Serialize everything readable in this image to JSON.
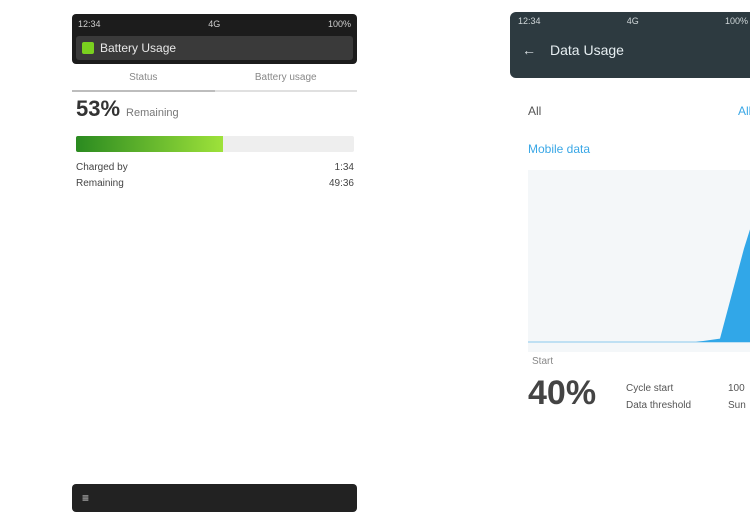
{
  "left": {
    "status": {
      "left": "12:34",
      "center": "4G",
      "right": "100%"
    },
    "title": "Battery Usage",
    "tabs": [
      "Status",
      "Battery usage"
    ],
    "percent": "53%",
    "percent_label": "Remaining",
    "level": 0.53,
    "stats": [
      {
        "label": "Charged by",
        "value": "1:34"
      },
      {
        "label": "Remaining",
        "value": "49:36"
      }
    ],
    "nav_icon": "menu-icon"
  },
  "right": {
    "status": {
      "left": "12:34",
      "center": "4G",
      "right": "100%"
    },
    "title": "Data Usage",
    "tab_label": "All",
    "tab_indicator": "All",
    "link": "Mobile data",
    "chart_x_label": "Start",
    "percent": "40%",
    "meta": [
      "Cycle start",
      "Data threshold"
    ],
    "meta2": [
      "100",
      "Sun"
    ]
  },
  "chart_data": {
    "type": "area",
    "x": [
      0,
      1,
      2,
      3,
      4,
      5,
      6,
      7,
      8,
      9,
      10
    ],
    "y": [
      0,
      0,
      0,
      0,
      0,
      0,
      0,
      0,
      2,
      55,
      100
    ],
    "title": "",
    "xlabel": "",
    "ylabel": "",
    "ylim": [
      0,
      100
    ],
    "grid": false,
    "color": "#31a7e8"
  }
}
